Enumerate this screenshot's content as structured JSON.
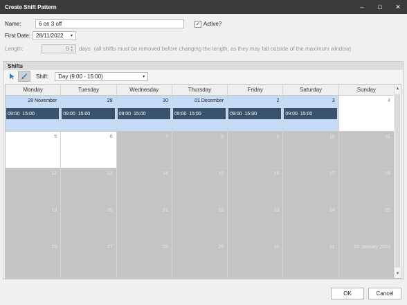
{
  "window": {
    "title": "Create Shift Pattern",
    "minimize": "–",
    "maximize": "□",
    "close": "✕"
  },
  "form": {
    "name_label": "Name:",
    "name_value": "6 on 3 off",
    "active_label": "Active?",
    "active_checked": true,
    "first_date_label": "First Date:",
    "first_date_value": "28/11/2022",
    "length_label": "Length:",
    "length_value": "9",
    "length_unit": "days",
    "length_note": "(all shifts must be removed before changing the length, as they may fall outside of the maximum window)"
  },
  "shifts": {
    "group_title": "Shifts",
    "shift_label": "Shift:",
    "shift_value": "Day (9:00 - 15:00)",
    "days": [
      "Monday",
      "Tuesday",
      "Wednesday",
      "Thursday",
      "Friday",
      "Saturday",
      "Sunday"
    ],
    "weeks": [
      [
        {
          "date": "28 November",
          "state": "pattern",
          "shift": "09:00  15:00"
        },
        {
          "date": "29",
          "state": "pattern",
          "shift": "09:00  15:00"
        },
        {
          "date": "30",
          "state": "pattern",
          "shift": "09:00  15:00"
        },
        {
          "date": "01 December",
          "state": "pattern",
          "shift": "09:00  15:00"
        },
        {
          "date": "2",
          "state": "pattern",
          "shift": "09:00  15:00"
        },
        {
          "date": "3",
          "state": "pattern",
          "shift": "09:00  15:00"
        },
        {
          "date": "4",
          "state": "white",
          "shift": ""
        }
      ],
      [
        {
          "date": "5",
          "state": "white",
          "shift": ""
        },
        {
          "date": "6",
          "state": "white",
          "shift": ""
        },
        {
          "date": "7",
          "state": "grey",
          "shift": ""
        },
        {
          "date": "8",
          "state": "grey",
          "shift": ""
        },
        {
          "date": "9",
          "state": "grey",
          "shift": ""
        },
        {
          "date": "10",
          "state": "grey",
          "shift": ""
        },
        {
          "date": "11",
          "state": "grey",
          "shift": ""
        }
      ],
      [
        {
          "date": "12",
          "state": "grey",
          "shift": ""
        },
        {
          "date": "13",
          "state": "grey",
          "shift": ""
        },
        {
          "date": "14",
          "state": "grey",
          "shift": ""
        },
        {
          "date": "15",
          "state": "grey",
          "shift": ""
        },
        {
          "date": "16",
          "state": "grey",
          "shift": ""
        },
        {
          "date": "17",
          "state": "grey",
          "shift": ""
        },
        {
          "date": "18",
          "state": "grey",
          "shift": ""
        }
      ],
      [
        {
          "date": "19",
          "state": "grey",
          "shift": ""
        },
        {
          "date": "20",
          "state": "grey",
          "shift": ""
        },
        {
          "date": "21",
          "state": "grey",
          "shift": ""
        },
        {
          "date": "22",
          "state": "grey",
          "shift": ""
        },
        {
          "date": "23",
          "state": "grey",
          "shift": ""
        },
        {
          "date": "24",
          "state": "grey",
          "shift": ""
        },
        {
          "date": "25",
          "state": "grey",
          "shift": ""
        }
      ],
      [
        {
          "date": "26",
          "state": "grey",
          "shift": ""
        },
        {
          "date": "27",
          "state": "grey",
          "shift": ""
        },
        {
          "date": "28",
          "state": "grey",
          "shift": ""
        },
        {
          "date": "29",
          "state": "grey",
          "shift": ""
        },
        {
          "date": "30",
          "state": "grey",
          "shift": ""
        },
        {
          "date": "31",
          "state": "grey",
          "shift": ""
        },
        {
          "date": "01 January 2023",
          "state": "grey",
          "shift": ""
        }
      ]
    ]
  },
  "buttons": {
    "ok": "OK",
    "cancel": "Cancel"
  },
  "colors": {
    "titlebar": "#3c3c3c",
    "pattern_day": "#c6dcf6",
    "shift_bar": "#3a536c",
    "outside_window": "#c4c4c4"
  }
}
